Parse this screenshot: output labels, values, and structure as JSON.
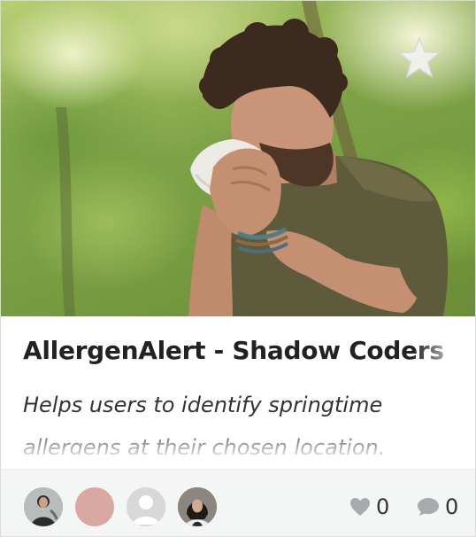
{
  "card": {
    "title": "AllergenAlert - Shadow Coders",
    "description": "Helps users to identify springtime allergens at their chosen location.",
    "photo_alt": "man-sneezing-into-tissue-outdoors",
    "star_icon": "star-icon",
    "likes_count": "0",
    "comments_count": "0"
  },
  "colors": {
    "heart": "#a8aaad",
    "comment": "#a8aaad",
    "footer_bg": "#f4f5f5",
    "title": "#222222"
  },
  "team_avatars": [
    {
      "name": "member-1"
    },
    {
      "name": "member-2"
    },
    {
      "name": "member-3"
    },
    {
      "name": "member-4"
    }
  ]
}
